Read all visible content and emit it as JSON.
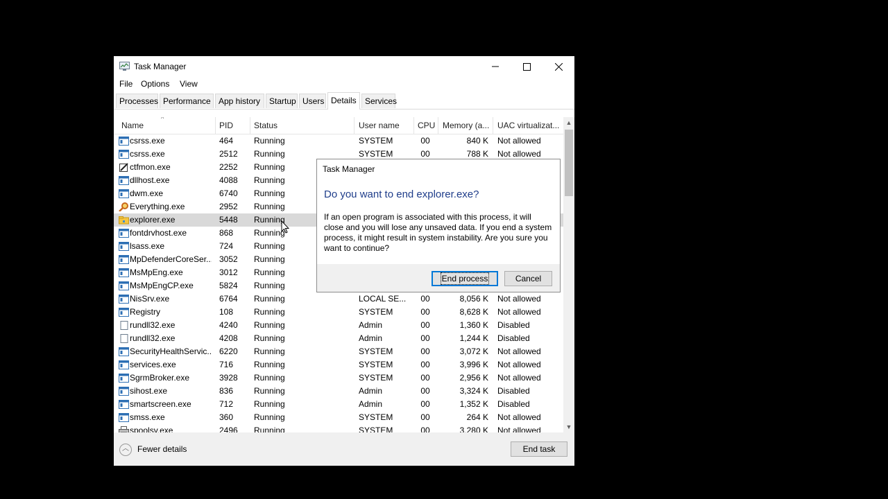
{
  "window": {
    "title": "Task Manager",
    "menu": [
      "File",
      "Options",
      "View"
    ],
    "tabs": [
      "Processes",
      "Performance",
      "App history",
      "Startup",
      "Users",
      "Details",
      "Services"
    ],
    "active_tab": "Details"
  },
  "table": {
    "columns": [
      "Name",
      "PID",
      "Status",
      "User name",
      "CPU",
      "Memory (a...",
      "UAC virtualizat..."
    ],
    "rows": [
      {
        "icon": "app-window-icon",
        "name": "csrss.exe",
        "pid": "464",
        "status": "Running",
        "user": "SYSTEM",
        "cpu": "00",
        "mem": "840 K",
        "uac": "Not allowed"
      },
      {
        "icon": "app-window-icon",
        "name": "csrss.exe",
        "pid": "2512",
        "status": "Running",
        "user": "SYSTEM",
        "cpu": "00",
        "mem": "788 K",
        "uac": "Not allowed"
      },
      {
        "icon": "pen-notepad-icon",
        "name": "ctfmon.exe",
        "pid": "2252",
        "status": "Running",
        "user": "",
        "cpu": "",
        "mem": "",
        "uac": ""
      },
      {
        "icon": "app-window-icon",
        "name": "dllhost.exe",
        "pid": "4088",
        "status": "Running",
        "user": "",
        "cpu": "",
        "mem": "",
        "uac": ""
      },
      {
        "icon": "app-window-icon",
        "name": "dwm.exe",
        "pid": "6740",
        "status": "Running",
        "user": "",
        "cpu": "",
        "mem": "",
        "uac": ""
      },
      {
        "icon": "magnifier-icon",
        "name": "Everything.exe",
        "pid": "2952",
        "status": "Running",
        "user": "",
        "cpu": "",
        "mem": "",
        "uac": ""
      },
      {
        "icon": "folder-icon",
        "name": "explorer.exe",
        "pid": "5448",
        "status": "Running",
        "user": "",
        "cpu": "",
        "mem": "",
        "uac": "",
        "selected": true
      },
      {
        "icon": "app-window-icon",
        "name": "fontdrvhost.exe",
        "pid": "868",
        "status": "Running",
        "user": "",
        "cpu": "",
        "mem": "",
        "uac": ""
      },
      {
        "icon": "app-window-icon",
        "name": "lsass.exe",
        "pid": "724",
        "status": "Running",
        "user": "",
        "cpu": "",
        "mem": "",
        "uac": ""
      },
      {
        "icon": "app-window-icon",
        "name": "MpDefenderCoreSer...",
        "pid": "3052",
        "status": "Running",
        "user": "",
        "cpu": "",
        "mem": "",
        "uac": ""
      },
      {
        "icon": "app-window-icon",
        "name": "MsMpEng.exe",
        "pid": "3012",
        "status": "Running",
        "user": "",
        "cpu": "",
        "mem": "",
        "uac": ""
      },
      {
        "icon": "app-window-icon",
        "name": "MsMpEngCP.exe",
        "pid": "5824",
        "status": "Running",
        "user": "",
        "cpu": "",
        "mem": "",
        "uac": ""
      },
      {
        "icon": "app-window-icon",
        "name": "NisSrv.exe",
        "pid": "6764",
        "status": "Running",
        "user": "LOCAL SE...",
        "cpu": "00",
        "mem": "8,056 K",
        "uac": "Not allowed"
      },
      {
        "icon": "app-window-icon",
        "name": "Registry",
        "pid": "108",
        "status": "Running",
        "user": "SYSTEM",
        "cpu": "00",
        "mem": "8,628 K",
        "uac": "Not allowed"
      },
      {
        "icon": "blank-page-icon",
        "name": "rundll32.exe",
        "pid": "4240",
        "status": "Running",
        "user": "Admin",
        "cpu": "00",
        "mem": "1,360 K",
        "uac": "Disabled"
      },
      {
        "icon": "blank-page-icon",
        "name": "rundll32.exe",
        "pid": "4208",
        "status": "Running",
        "user": "Admin",
        "cpu": "00",
        "mem": "1,244 K",
        "uac": "Disabled"
      },
      {
        "icon": "app-window-icon",
        "name": "SecurityHealthServic...",
        "pid": "6220",
        "status": "Running",
        "user": "SYSTEM",
        "cpu": "00",
        "mem": "3,072 K",
        "uac": "Not allowed"
      },
      {
        "icon": "app-window-icon",
        "name": "services.exe",
        "pid": "716",
        "status": "Running",
        "user": "SYSTEM",
        "cpu": "00",
        "mem": "3,996 K",
        "uac": "Not allowed"
      },
      {
        "icon": "app-window-icon",
        "name": "SgrmBroker.exe",
        "pid": "3928",
        "status": "Running",
        "user": "SYSTEM",
        "cpu": "00",
        "mem": "2,956 K",
        "uac": "Not allowed"
      },
      {
        "icon": "app-window-icon",
        "name": "sihost.exe",
        "pid": "836",
        "status": "Running",
        "user": "Admin",
        "cpu": "00",
        "mem": "3,324 K",
        "uac": "Disabled"
      },
      {
        "icon": "app-window-icon",
        "name": "smartscreen.exe",
        "pid": "712",
        "status": "Running",
        "user": "Admin",
        "cpu": "00",
        "mem": "1,352 K",
        "uac": "Disabled"
      },
      {
        "icon": "app-window-icon",
        "name": "smss.exe",
        "pid": "360",
        "status": "Running",
        "user": "SYSTEM",
        "cpu": "00",
        "mem": "264 K",
        "uac": "Not allowed"
      },
      {
        "icon": "printer-icon",
        "name": "spoolsv.exe",
        "pid": "2496",
        "status": "Running",
        "user": "SYSTEM",
        "cpu": "00",
        "mem": "3,280 K",
        "uac": "Not allowed"
      }
    ]
  },
  "footer": {
    "fewer_details": "Fewer details",
    "end_task": "End task"
  },
  "dialog": {
    "title": "Task Manager",
    "heading": "Do you want to end explorer.exe?",
    "body": "If an open program is associated with this process, it will close and you will lose any unsaved data. If you end a system process, it might result in system instability. Are you sure you want to continue?",
    "confirm": "End process",
    "cancel": "Cancel"
  },
  "colors": {
    "heading": "#1f3d8a",
    "focus_border": "#0078d7",
    "selected_row": "#d9d9d9"
  }
}
